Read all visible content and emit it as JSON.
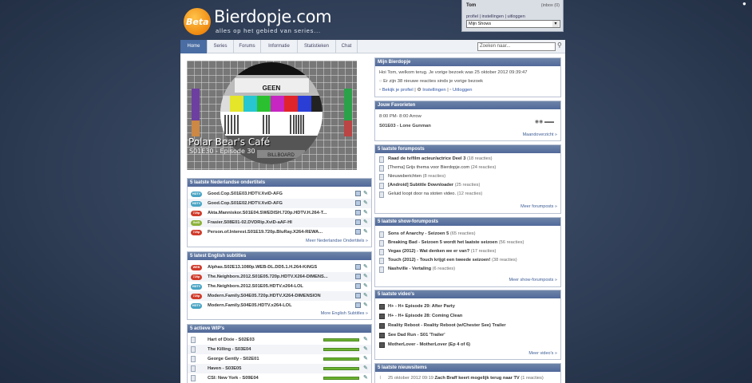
{
  "brand": {
    "beta": "Beta",
    "name": "Bierdopje.com",
    "tagline": "alles op het gebied van series..."
  },
  "userbox": {
    "user": "Tom",
    "inbox": "(inbox (0)",
    "links": "profiel | instellingen | uitloggen",
    "select": "Mijn Shows"
  },
  "nav": {
    "tabs": [
      "Home",
      "Series",
      "Forums",
      "Informatie",
      "Statistieken",
      "Chat"
    ],
    "active": "Home",
    "search_placeholder": "Zoeken naar..."
  },
  "hero": {
    "screen_text": "GEEN",
    "billboard": "BILLBOARD",
    "title": "Polar Bear's Café",
    "episode": "S01E30 - Episode 30"
  },
  "nl_subs": {
    "title": "5 laatste Nederlandse ondertitels",
    "rows": [
      {
        "badge": "HDTV",
        "type": "hdtv",
        "text": "Good.Cop.S01E03.HDTV.XviD-AFG"
      },
      {
        "badge": "HDTV",
        "type": "hdtv",
        "text": "Good.Cop.S01E02.HDTV.XviD-AFG"
      },
      {
        "badge": "720p",
        "type": "720p",
        "text": "Akta.Manniskor.S01E04.SWEDISH.720p.HDTV.H.264-T..."
      },
      {
        "badge": "XviD",
        "type": "xvid",
        "text": "Frasier.S08E01-02.DVDRip.XviD-aAF-HI"
      },
      {
        "badge": "720p",
        "type": "720p",
        "text": "Person.of.Interest.S01E19.720p.BluRay.X264-REWA..."
      }
    ],
    "more": "Meer Nederlandse Ondertitels »"
  },
  "en_subs": {
    "title": "5 latest English subtitles",
    "rows": [
      {
        "badge": "WEB",
        "type": "720p",
        "text": "Alphas.S02E13.1080p.WEB-DL.DD5.1.H.264-KiNGS"
      },
      {
        "badge": "720p",
        "type": "720p",
        "text": "The.Neighbors.2012.S01E05.720p.HDTV.X264-DIMENS..."
      },
      {
        "badge": "HDTV",
        "type": "hdtv",
        "text": "The.Neighbors.2012.S01E05.HDTV.x264-LOL"
      },
      {
        "badge": "720p",
        "type": "720p",
        "text": "Modern.Family.S04E05.720p.HDTV.X264-DIMENSION"
      },
      {
        "badge": "HDTV",
        "type": "hdtv",
        "text": "Modern.Family.S04E05.HDTV.x264-LOL"
      }
    ],
    "more": "More English Subtitles »"
  },
  "wip": {
    "title": "5 actieve WIP's",
    "rows": [
      {
        "text": "Hart of Dixie - S02E03",
        "progress": 1.0
      },
      {
        "text": "The Killing - S03E04",
        "progress": 1.0
      },
      {
        "text": "George Gently - S02E01",
        "progress": 1.0
      },
      {
        "text": "Haven - S03E05",
        "progress": 1.0
      },
      {
        "text": "CSI: New York - S09E04",
        "progress": 1.0
      }
    ]
  },
  "mijn": {
    "title": "Mijn Bierdopje",
    "welcome": "Hoi Tom, welkom terug. Je vorige bezoek was 25 oktober 2012 09:39:47",
    "new_reactions": "Er zijn 38 nieuwe reacties sinds je vorige bezoek",
    "links": [
      "Bekijk je profiel",
      "Instellingen",
      "Uitloggen"
    ]
  },
  "favorieten": {
    "title": "Jouw Favorieten",
    "time": "8:00 PM- 8:00 Arrow",
    "episode": "S01E03 - Lone Gunman",
    "more": "Maandoverzicht »"
  },
  "forumposts": {
    "title": "5 laatste forumposts",
    "rows": [
      {
        "text": "Raad de tv/film acteur/actrice Deel 3",
        "count": "(18 reacties)",
        "bold": true
      },
      {
        "text": "[Thema] Grijs thema voor Bierdopje.com",
        "count": "(24 reacties)",
        "bold": false
      },
      {
        "text": "Nieuwsberichten",
        "count": "(8 reacties)",
        "bold": false
      },
      {
        "text": "[Android] Subtitle Downloader",
        "count": "(25 reacties)",
        "bold": true
      },
      {
        "text": "Geluid loopt door na stoten video.",
        "count": "(12 reacties)",
        "bold": false
      }
    ],
    "more": "Meer forumposts »"
  },
  "showposts": {
    "title": "5 laatste show-forumposts",
    "rows": [
      {
        "text": "Sons of Anarchy - Seizoen 5",
        "count": "(65 reacties)"
      },
      {
        "text": "Breaking Bad - Seizoen 5 wordt het laatste seizoen",
        "count": "(56 reacties)"
      },
      {
        "text": "Vegas (2012) - Wat denken we er van?",
        "count": "(17 reacties)"
      },
      {
        "text": "Touch (2012) - Touch krijgt een tweede seizoen!",
        "count": "(38 reacties)"
      },
      {
        "text": "Nashville - Vertaling",
        "count": "(6 reacties)"
      }
    ],
    "more": "Meer show-forumposts »"
  },
  "videos": {
    "title": "5 laatste video's",
    "rows": [
      "H+ - H+ Episode 29: After Party",
      "H+ - H+ Episode 28: Coming Clean",
      "Reality Reboot - Reality Reboot (w/Chester See) Trailer",
      "See Dad Run - S01 'Trailer'",
      "MotherLover - MotherLover (Ep 4 of 6)"
    ],
    "more": "Meer video's »"
  },
  "news": {
    "title": "5 laatste nieuwsitems",
    "date": "25 oktober 2012 09:19",
    "headline": "Zach Braff keert mogelijk terug naar TV",
    "count": "(1 reacties)"
  }
}
